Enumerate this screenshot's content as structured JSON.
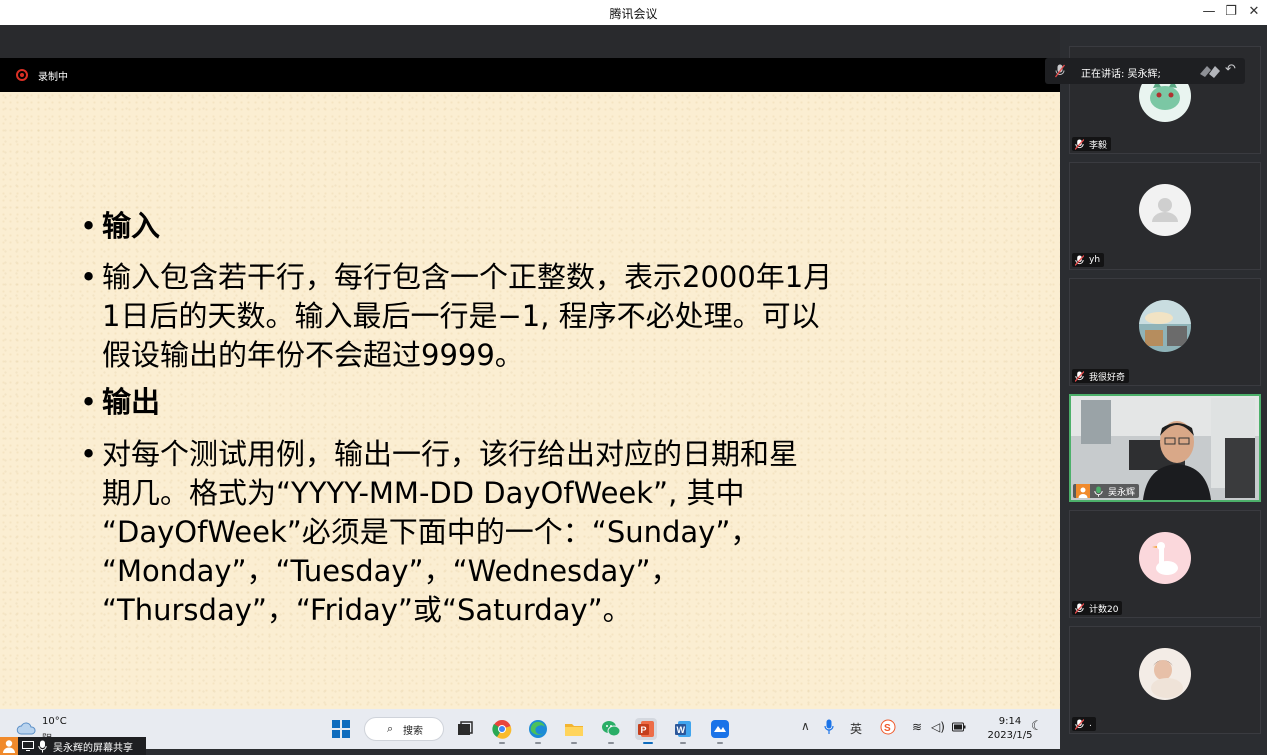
{
  "window": {
    "title": "腾讯会议"
  },
  "recording": {
    "label": "录制中"
  },
  "speaking": {
    "text": "正在讲话: 吴永辉;"
  },
  "slide": {
    "bullets": [
      {
        "symbol": "•",
        "text": "输入",
        "heading": true
      },
      {
        "symbol": "•",
        "text": "输入包含若干行，每行包含一个正整数，表示2000年1月\n1日后的天数。输入最后一行是−1, 程序不必处理。可以\n假设输出的年份不会超过9999。",
        "heading": false
      },
      {
        "symbol": "•",
        "text": "输出",
        "heading": true
      },
      {
        "symbol": "•",
        "text": "对每个测试用例，输出一行，该行给出对应的日期和星\n期几。格式为“YYYY-MM-DD DayOfWeek”, 其中\n“DayOfWeek”必须是下面中的一个：“Sunday”，\n“Monday”，“Tuesday”，“Wednesday”，\n“Thursday”，“Friday”或“Saturday”。",
        "heading": false
      }
    ]
  },
  "taskbar": {
    "weather": {
      "temp": "10°C",
      "desc": "阴"
    },
    "search": {
      "label": "搜索",
      "icon": "search-icon"
    },
    "apps": [
      {
        "name": "task-view",
        "color": "#2b2b2b"
      },
      {
        "name": "chrome",
        "color": "#e8453c"
      },
      {
        "name": "edge",
        "color": "#1d8bd6"
      },
      {
        "name": "file-explorer",
        "color": "#f3b431"
      },
      {
        "name": "wechat",
        "color": "#2aae67"
      },
      {
        "name": "powerpoint",
        "color": "#c43e1c"
      },
      {
        "name": "word",
        "color": "#2b579a"
      },
      {
        "name": "tencent-meeting",
        "color": "#1a73e8"
      }
    ],
    "tray": {
      "ime": "英"
    },
    "clock": {
      "time": "9:14",
      "date": "2023/1/5"
    }
  },
  "participants": [
    {
      "name": "李毅",
      "muted": true,
      "avatar": "cartoon-avatar"
    },
    {
      "name": "yh",
      "muted": true,
      "avatar": "default-avatar"
    },
    {
      "name": "我很好奇",
      "muted": true,
      "avatar": "scenery-avatar"
    },
    {
      "name": "吴永辉",
      "muted": false,
      "host": true,
      "video": true
    },
    {
      "name": "计数20",
      "muted": true,
      "avatar": "goose-avatar"
    },
    {
      "name": ".",
      "muted": true,
      "avatar": "photo-avatar"
    }
  ],
  "share_label": {
    "text": "吴永辉的屏幕共享"
  },
  "colors": {
    "slide_bg": "#fbeed2",
    "active_border": "#4cb06a",
    "record_red": "#d93025",
    "host_orange": "#f08a2c"
  }
}
